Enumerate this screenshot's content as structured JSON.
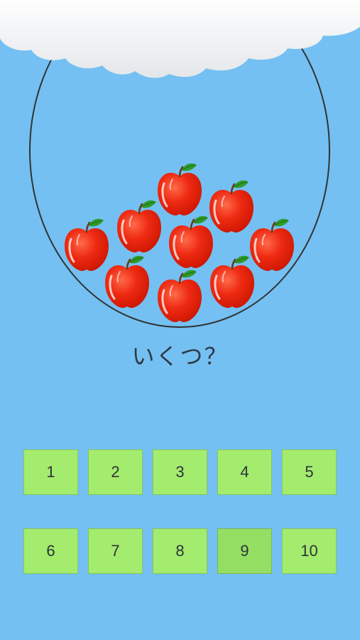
{
  "question": "いくつ？",
  "apple_count_shown": 9,
  "answers": [
    {
      "label": "1",
      "pressed": false
    },
    {
      "label": "2",
      "pressed": false
    },
    {
      "label": "3",
      "pressed": false
    },
    {
      "label": "4",
      "pressed": false
    },
    {
      "label": "5",
      "pressed": false
    },
    {
      "label": "6",
      "pressed": false
    },
    {
      "label": "7",
      "pressed": false
    },
    {
      "label": "8",
      "pressed": false
    },
    {
      "label": "9",
      "pressed": true
    },
    {
      "label": "10",
      "pressed": false
    }
  ],
  "colors": {
    "background": "#74c0f2",
    "button": "#a4ec6e",
    "button_pressed": "#95de64",
    "apple": "#e8200c",
    "leaf": "#2f9a2a",
    "cloud": "#ffffff",
    "bag_outline": "#333333"
  }
}
